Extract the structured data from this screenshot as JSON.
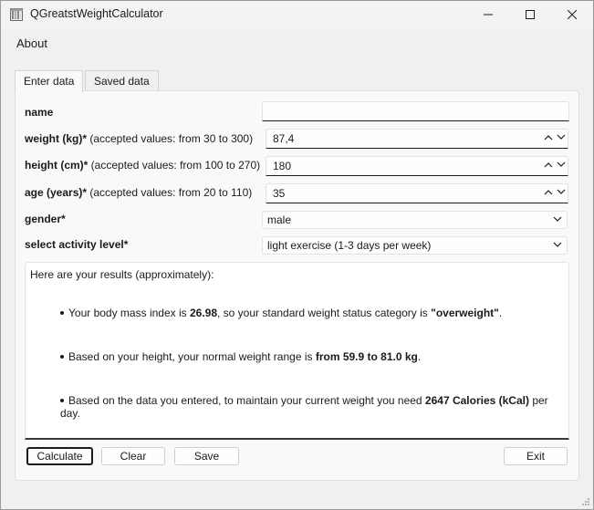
{
  "window": {
    "title": "QGreatstWeightCalculator",
    "minimize_icon": "minimize-icon",
    "maximize_icon": "maximize-icon",
    "close_icon": "close-icon"
  },
  "menu": {
    "about": "About"
  },
  "tabs": [
    {
      "label": "Enter data",
      "active": true
    },
    {
      "label": "Saved data",
      "active": false
    }
  ],
  "form": {
    "name": {
      "label": "name",
      "value": ""
    },
    "weight": {
      "label": "weight (kg)*",
      "hint": " (accepted values: from 30 to 300)",
      "value": "87,4"
    },
    "height": {
      "label": "height (cm)*",
      "hint": " (accepted values: from 100 to 270)",
      "value": "180"
    },
    "age": {
      "label": "age (years)*",
      "hint": " (accepted values: from 20 to 110)",
      "value": "35"
    },
    "gender": {
      "label": "gender*",
      "value": "male"
    },
    "activity": {
      "label": "select activity level*",
      "value": "light exercise (1-3 days per week)"
    }
  },
  "results": {
    "intro": "Here are your results (approximately):",
    "bmi": {
      "pre": "Your body mass index is ",
      "value": "26.98",
      "mid": ", so your standard weight status category is ",
      "category": "\"overweight\"",
      "post": "."
    },
    "range": {
      "pre": "Based on your height, your normal weight range is ",
      "value": "from 59.9 to 81.0 kg",
      "post": "."
    },
    "calories": {
      "pre": "Based on the data you entered, to maintain your current weight you need ",
      "value": "2647 Calories (kCal)",
      "post": " per day."
    }
  },
  "buttons": {
    "calculate": "Calculate",
    "clear": "Clear",
    "save": "Save",
    "exit": "Exit"
  },
  "colors": {
    "window_bg": "#f0f0f0",
    "panel_bg": "#f9f9f9",
    "text": "#1b1b1b",
    "focus_border": "#1b1b1b"
  }
}
